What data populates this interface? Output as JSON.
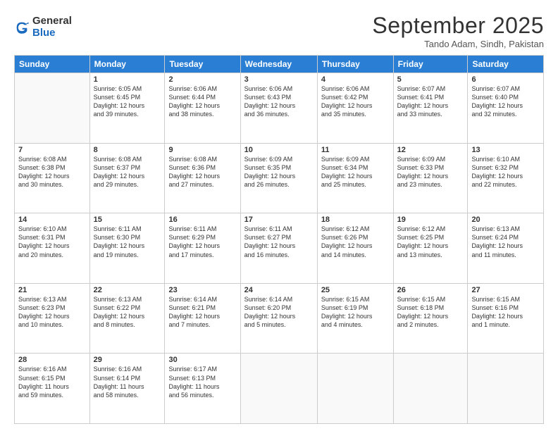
{
  "logo": {
    "general": "General",
    "blue": "Blue"
  },
  "header": {
    "month": "September 2025",
    "location": "Tando Adam, Sindh, Pakistan"
  },
  "weekdays": [
    "Sunday",
    "Monday",
    "Tuesday",
    "Wednesday",
    "Thursday",
    "Friday",
    "Saturday"
  ],
  "weeks": [
    [
      {
        "day": "",
        "info": ""
      },
      {
        "day": "1",
        "info": "Sunrise: 6:05 AM\nSunset: 6:45 PM\nDaylight: 12 hours\nand 39 minutes."
      },
      {
        "day": "2",
        "info": "Sunrise: 6:06 AM\nSunset: 6:44 PM\nDaylight: 12 hours\nand 38 minutes."
      },
      {
        "day": "3",
        "info": "Sunrise: 6:06 AM\nSunset: 6:43 PM\nDaylight: 12 hours\nand 36 minutes."
      },
      {
        "day": "4",
        "info": "Sunrise: 6:06 AM\nSunset: 6:42 PM\nDaylight: 12 hours\nand 35 minutes."
      },
      {
        "day": "5",
        "info": "Sunrise: 6:07 AM\nSunset: 6:41 PM\nDaylight: 12 hours\nand 33 minutes."
      },
      {
        "day": "6",
        "info": "Sunrise: 6:07 AM\nSunset: 6:40 PM\nDaylight: 12 hours\nand 32 minutes."
      }
    ],
    [
      {
        "day": "7",
        "info": "Sunrise: 6:08 AM\nSunset: 6:38 PM\nDaylight: 12 hours\nand 30 minutes."
      },
      {
        "day": "8",
        "info": "Sunrise: 6:08 AM\nSunset: 6:37 PM\nDaylight: 12 hours\nand 29 minutes."
      },
      {
        "day": "9",
        "info": "Sunrise: 6:08 AM\nSunset: 6:36 PM\nDaylight: 12 hours\nand 27 minutes."
      },
      {
        "day": "10",
        "info": "Sunrise: 6:09 AM\nSunset: 6:35 PM\nDaylight: 12 hours\nand 26 minutes."
      },
      {
        "day": "11",
        "info": "Sunrise: 6:09 AM\nSunset: 6:34 PM\nDaylight: 12 hours\nand 25 minutes."
      },
      {
        "day": "12",
        "info": "Sunrise: 6:09 AM\nSunset: 6:33 PM\nDaylight: 12 hours\nand 23 minutes."
      },
      {
        "day": "13",
        "info": "Sunrise: 6:10 AM\nSunset: 6:32 PM\nDaylight: 12 hours\nand 22 minutes."
      }
    ],
    [
      {
        "day": "14",
        "info": "Sunrise: 6:10 AM\nSunset: 6:31 PM\nDaylight: 12 hours\nand 20 minutes."
      },
      {
        "day": "15",
        "info": "Sunrise: 6:11 AM\nSunset: 6:30 PM\nDaylight: 12 hours\nand 19 minutes."
      },
      {
        "day": "16",
        "info": "Sunrise: 6:11 AM\nSunset: 6:29 PM\nDaylight: 12 hours\nand 17 minutes."
      },
      {
        "day": "17",
        "info": "Sunrise: 6:11 AM\nSunset: 6:27 PM\nDaylight: 12 hours\nand 16 minutes."
      },
      {
        "day": "18",
        "info": "Sunrise: 6:12 AM\nSunset: 6:26 PM\nDaylight: 12 hours\nand 14 minutes."
      },
      {
        "day": "19",
        "info": "Sunrise: 6:12 AM\nSunset: 6:25 PM\nDaylight: 12 hours\nand 13 minutes."
      },
      {
        "day": "20",
        "info": "Sunrise: 6:13 AM\nSunset: 6:24 PM\nDaylight: 12 hours\nand 11 minutes."
      }
    ],
    [
      {
        "day": "21",
        "info": "Sunrise: 6:13 AM\nSunset: 6:23 PM\nDaylight: 12 hours\nand 10 minutes."
      },
      {
        "day": "22",
        "info": "Sunrise: 6:13 AM\nSunset: 6:22 PM\nDaylight: 12 hours\nand 8 minutes."
      },
      {
        "day": "23",
        "info": "Sunrise: 6:14 AM\nSunset: 6:21 PM\nDaylight: 12 hours\nand 7 minutes."
      },
      {
        "day": "24",
        "info": "Sunrise: 6:14 AM\nSunset: 6:20 PM\nDaylight: 12 hours\nand 5 minutes."
      },
      {
        "day": "25",
        "info": "Sunrise: 6:15 AM\nSunset: 6:19 PM\nDaylight: 12 hours\nand 4 minutes."
      },
      {
        "day": "26",
        "info": "Sunrise: 6:15 AM\nSunset: 6:18 PM\nDaylight: 12 hours\nand 2 minutes."
      },
      {
        "day": "27",
        "info": "Sunrise: 6:15 AM\nSunset: 6:16 PM\nDaylight: 12 hours\nand 1 minute."
      }
    ],
    [
      {
        "day": "28",
        "info": "Sunrise: 6:16 AM\nSunset: 6:15 PM\nDaylight: 11 hours\nand 59 minutes."
      },
      {
        "day": "29",
        "info": "Sunrise: 6:16 AM\nSunset: 6:14 PM\nDaylight: 11 hours\nand 58 minutes."
      },
      {
        "day": "30",
        "info": "Sunrise: 6:17 AM\nSunset: 6:13 PM\nDaylight: 11 hours\nand 56 minutes."
      },
      {
        "day": "",
        "info": ""
      },
      {
        "day": "",
        "info": ""
      },
      {
        "day": "",
        "info": ""
      },
      {
        "day": "",
        "info": ""
      }
    ]
  ]
}
